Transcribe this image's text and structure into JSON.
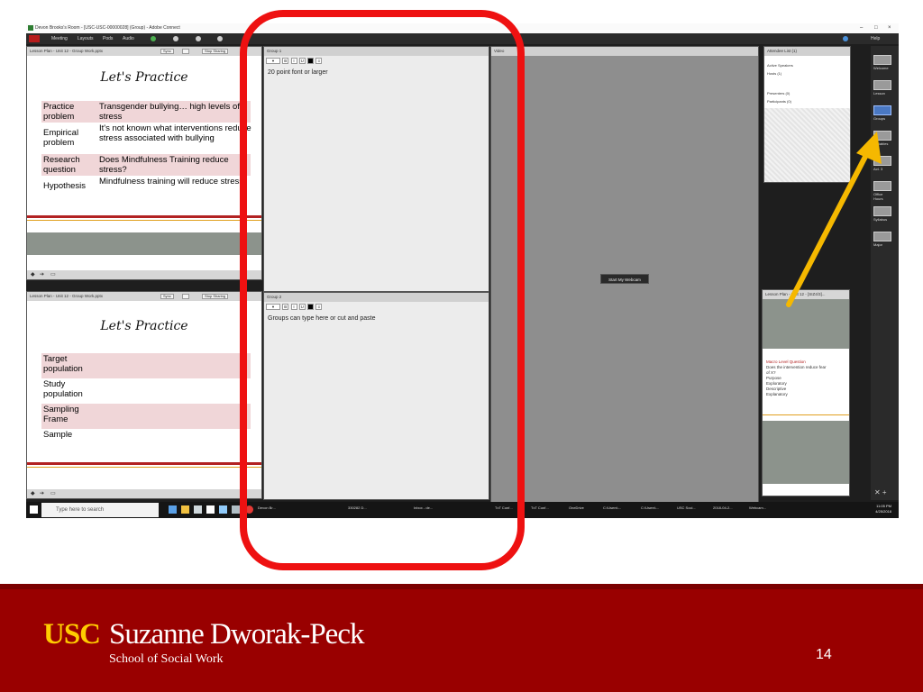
{
  "window": {
    "title": "Devon Brooks's Room - [USC-USC-00000028] (Group) - Adobe Connect",
    "controls": [
      "‒",
      "□",
      "×"
    ]
  },
  "menubar": {
    "items": [
      "Meeting",
      "Layouts",
      "Pods",
      "Audio"
    ],
    "help": "Help"
  },
  "pod_top": {
    "header": "Lesson Plan - Unit 12 - Group Work.pptx",
    "btn_sync": "Sync",
    "btn_stop": "Stop Sharing",
    "slide_title": "Let's Practice",
    "rows": [
      {
        "label": "Practice problem",
        "text": "Transgender bullying… high levels of stress"
      },
      {
        "label": "Empirical problem",
        "text": "It's not known what interventions reduce stress associated with bullying"
      },
      {
        "label": "Research question",
        "text": "Does Mindfulness Training reduce stress?"
      },
      {
        "label": "Hypothesis",
        "text": "Mindfulness training will reduce stress"
      }
    ]
  },
  "pod_bottom": {
    "header": "Lesson Plan - Unit 12 - Group Work.pptx",
    "btn_sync": "Sync",
    "btn_stop": "Stop Sharing",
    "slide_title": "Let's Practice",
    "rows": [
      {
        "label": "Target population",
        "text": ""
      },
      {
        "label": "Study population",
        "text": ""
      },
      {
        "label": "Sampling Frame",
        "text": ""
      },
      {
        "label": "Sample",
        "text": ""
      }
    ]
  },
  "group1": {
    "header": "Group 1",
    "text": "20 point font or larger"
  },
  "group2": {
    "header": "Group 2",
    "text": "Groups can type here or cut and paste"
  },
  "video": {
    "header": "Video",
    "webcam_button": "Start My Webcam"
  },
  "attendees": {
    "header": "Attendee List (1)",
    "rows": [
      "Active Speakers",
      "Hosts (1)",
      "Presenters (0)",
      "Participants (0)"
    ]
  },
  "lesson_small": {
    "header": "Lesson Plan - Unit 12 - [SIZ4/3]...",
    "lines": [
      "Macro Level Question",
      "Does the intervention reduce fear",
      "of X?",
      "Purpose",
      "Exploratory",
      "Descriptive",
      "Explanatory"
    ]
  },
  "layouts": {
    "items": [
      "Welcome",
      "Lesson",
      "Groups",
      "Variables",
      "Act. 3",
      "Office Hours",
      "Syllabus",
      "Major"
    ]
  },
  "taskbar": {
    "search_placeholder": "Type here to search",
    "apps": [
      "Devon Br...",
      "330282 D...",
      "Inbox - de...",
      "TxT Conf...",
      "TxT Conf...",
      "OneDrive",
      "C:\\Users\\...",
      "C:\\Users\\...",
      "USC Soci...",
      "2018-04-2...",
      "Webcam..."
    ],
    "time": "11:05 PM",
    "date": "4/25/2018"
  },
  "footer": {
    "logo_usc": "USC",
    "logo_name": "Suzanne Dworak-Peck",
    "logo_sub": "School of Social Work",
    "page_number": "14"
  },
  "colors": {
    "annotation_red": "#ee1111",
    "annotation_arrow": "#f5b800",
    "footer_maroon": "#990000",
    "usc_gold": "#ffcc00"
  }
}
